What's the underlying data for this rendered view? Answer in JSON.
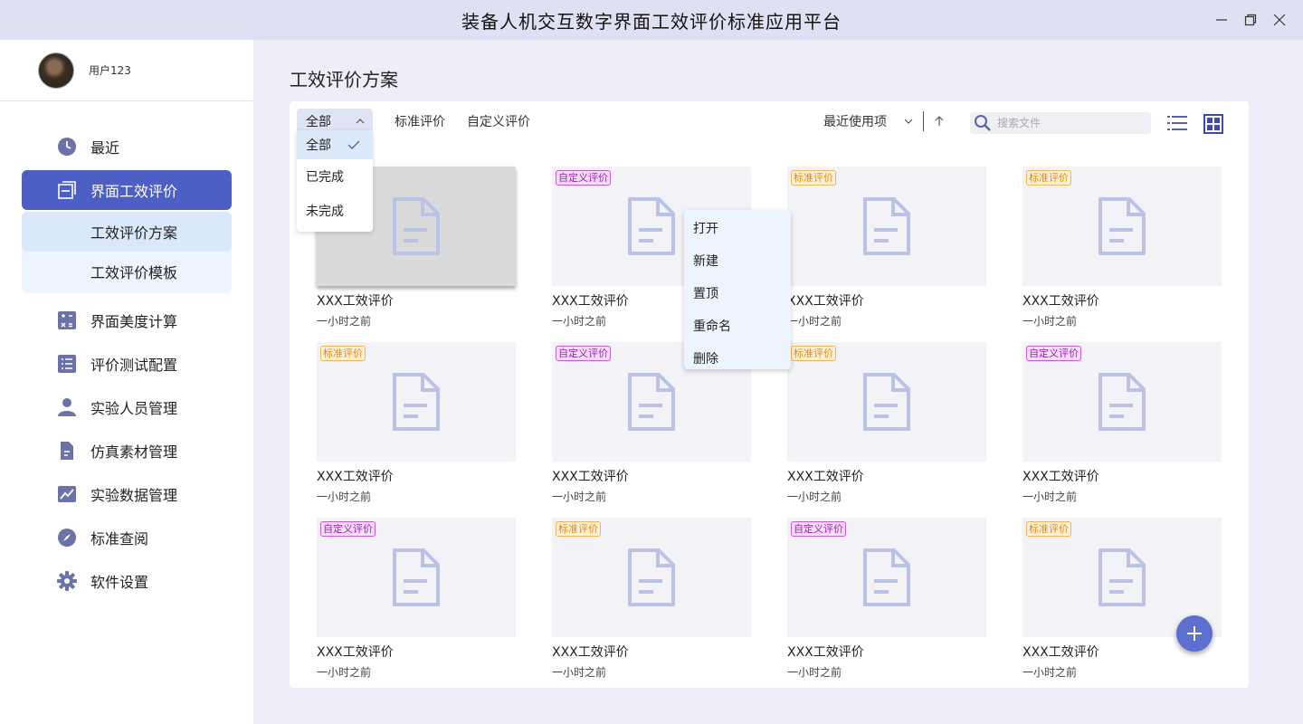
{
  "app": {
    "title": "装备人机交互数字界面工效评价标准应用平台"
  },
  "user": {
    "name": "用户123"
  },
  "sidebar": {
    "items": [
      {
        "label": "最近",
        "icon": "clock-icon"
      },
      {
        "label": "界面工效评价",
        "icon": "window-icon"
      },
      {
        "label": "界面美度计算",
        "icon": "calculator-icon"
      },
      {
        "label": "评价测试配置",
        "icon": "list-icon"
      },
      {
        "label": "实验人员管理",
        "icon": "person-icon"
      },
      {
        "label": "仿真素材管理",
        "icon": "document-icon"
      },
      {
        "label": "实验数据管理",
        "icon": "chart-icon"
      },
      {
        "label": "标准查阅",
        "icon": "compass-icon"
      },
      {
        "label": "软件设置",
        "icon": "gear-icon"
      }
    ],
    "subitems": [
      {
        "label": "工效评价方案"
      },
      {
        "label": "工效评价模板"
      }
    ]
  },
  "main": {
    "title": "工效评价方案",
    "filter": {
      "selected": "全部",
      "tabs": [
        "标准评价",
        "自定义评价"
      ],
      "options": [
        "全部",
        "已完成",
        "未完成"
      ]
    },
    "sort": {
      "label": "最近使用项"
    },
    "search": {
      "placeholder": "搜索文件"
    },
    "cards": [
      {
        "name": "XXX工效评价",
        "time": "一小时之前",
        "badge": ""
      },
      {
        "name": "XXX工效评价",
        "time": "一小时之前",
        "badge": "自定义评价"
      },
      {
        "name": "XXX工效评价",
        "time": "一小时之前",
        "badge": "标准评价"
      },
      {
        "name": "XXX工效评价",
        "time": "一小时之前",
        "badge": "标准评价"
      },
      {
        "name": "XXX工效评价",
        "time": "一小时之前",
        "badge": "标准评价"
      },
      {
        "name": "XXX工效评价",
        "time": "一小时之前",
        "badge": "自定义评价"
      },
      {
        "name": "XXX工效评价",
        "time": "一小时之前",
        "badge": "标准评价"
      },
      {
        "name": "XXX工效评价",
        "time": "一小时之前",
        "badge": "自定义评价"
      },
      {
        "name": "XXX工效评价",
        "time": "一小时之前",
        "badge": "自定义评价"
      },
      {
        "name": "XXX工效评价",
        "time": "一小时之前",
        "badge": "标准评价"
      },
      {
        "name": "XXX工效评价",
        "time": "一小时之前",
        "badge": "自定义评价"
      },
      {
        "name": "XXX工效评价",
        "time": "一小时之前",
        "badge": "标准评价"
      }
    ]
  },
  "context_menu": {
    "items": [
      "打开",
      "新建",
      "置顶",
      "重命名",
      "删除"
    ]
  },
  "colors": {
    "accent": "#4d5fc4",
    "std_badge": "#e08a1e",
    "custom_badge": "#a020b8"
  }
}
